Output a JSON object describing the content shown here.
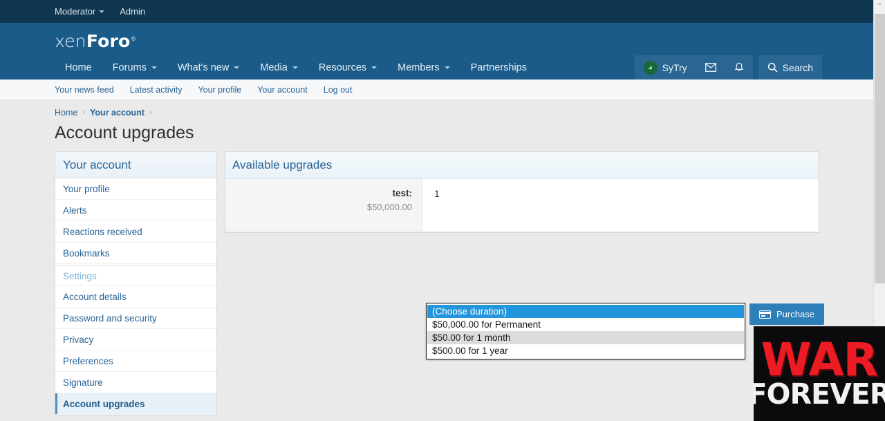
{
  "admin_bar": {
    "items": [
      {
        "label": "Moderator",
        "has_caret": true
      },
      {
        "label": "Admin",
        "has_caret": false
      }
    ]
  },
  "brand": {
    "thin": "xen",
    "bold": "Foro",
    "reg": "®"
  },
  "main_nav": {
    "items": [
      {
        "label": "Home",
        "has_caret": false,
        "active": false
      },
      {
        "label": "Forums",
        "has_caret": true,
        "active": false
      },
      {
        "label": "What's new",
        "has_caret": true,
        "active": false
      },
      {
        "label": "Media",
        "has_caret": true,
        "active": false
      },
      {
        "label": "Resources",
        "has_caret": true,
        "active": false
      },
      {
        "label": "Members",
        "has_caret": true,
        "active": false
      },
      {
        "label": "Partnerships",
        "has_caret": false,
        "active": false
      }
    ]
  },
  "header_right": {
    "username": "SyTry",
    "avatar_icon": "user-avatar-icon",
    "inbox_icon": "envelope-icon",
    "alerts_icon": "bell-icon",
    "search_label": "Search",
    "search_icon": "search-icon"
  },
  "sub_nav": {
    "items": [
      "Your news feed",
      "Latest activity",
      "Your profile",
      "Your account",
      "Log out"
    ]
  },
  "breadcrumb": {
    "items": [
      {
        "label": "Home",
        "strong": false
      },
      {
        "label": "Your account",
        "strong": true
      }
    ],
    "separator": "›"
  },
  "page_title": "Account upgrades",
  "sidebar": {
    "heading": "Your account",
    "items": [
      {
        "label": "Your profile",
        "type": "link",
        "active": false
      },
      {
        "label": "Alerts",
        "type": "link",
        "active": false
      },
      {
        "label": "Reactions received",
        "type": "link",
        "active": false
      },
      {
        "label": "Bookmarks",
        "type": "link",
        "active": false
      },
      {
        "label": "Settings",
        "type": "group",
        "active": false
      },
      {
        "label": "Account details",
        "type": "link",
        "active": false
      },
      {
        "label": "Password and security",
        "type": "link",
        "active": false
      },
      {
        "label": "Privacy",
        "type": "link",
        "active": false
      },
      {
        "label": "Preferences",
        "type": "link",
        "active": false
      },
      {
        "label": "Signature",
        "type": "link",
        "active": false
      },
      {
        "label": "Account upgrades",
        "type": "link",
        "active": true
      }
    ]
  },
  "card": {
    "heading": "Available upgrades",
    "row": {
      "title": "test:",
      "price": "$50,000.00",
      "quantity": "1"
    }
  },
  "duration_select": {
    "expanded": true,
    "options": [
      {
        "label": "(Choose duration)",
        "selected": true,
        "alt": false
      },
      {
        "label": "$50,000.00 for Permanent",
        "selected": false,
        "alt": false
      },
      {
        "label": "$50.00 for 1 month",
        "selected": false,
        "alt": true
      },
      {
        "label": "$500.00 for 1 year",
        "selected": false,
        "alt": false
      }
    ]
  },
  "purchase_button": {
    "label": "Purchase",
    "icon": "credit-card-icon"
  },
  "scrollbar": {
    "up_arrow": "⌃"
  },
  "ad_overlay": {
    "line1": "WAR",
    "line2": "FOREVER"
  },
  "colors": {
    "admin_bar": "#10364f",
    "header": "#1a5b8a",
    "link": "#2a6496",
    "accent_button": "#2e7fb8",
    "select_highlight": "#2196dd",
    "ad_red": "#ed1c24"
  }
}
